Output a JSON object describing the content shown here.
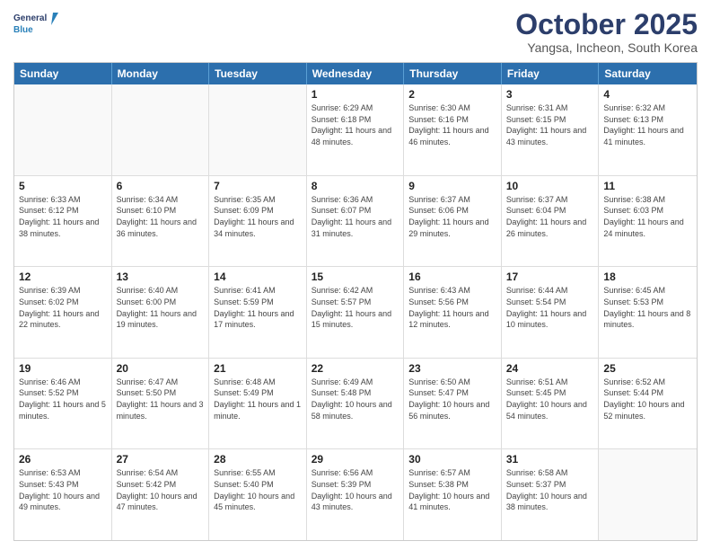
{
  "header": {
    "logo_line1": "General",
    "logo_line2": "Blue",
    "month_title": "October 2025",
    "location": "Yangsa, Incheon, South Korea"
  },
  "days_of_week": [
    "Sunday",
    "Monday",
    "Tuesday",
    "Wednesday",
    "Thursday",
    "Friday",
    "Saturday"
  ],
  "weeks": [
    [
      {
        "day": "",
        "empty": true
      },
      {
        "day": "",
        "empty": true
      },
      {
        "day": "",
        "empty": true
      },
      {
        "day": "1",
        "info": "Sunrise: 6:29 AM\nSunset: 6:18 PM\nDaylight: 11 hours\nand 48 minutes."
      },
      {
        "day": "2",
        "info": "Sunrise: 6:30 AM\nSunset: 6:16 PM\nDaylight: 11 hours\nand 46 minutes."
      },
      {
        "day": "3",
        "info": "Sunrise: 6:31 AM\nSunset: 6:15 PM\nDaylight: 11 hours\nand 43 minutes."
      },
      {
        "day": "4",
        "info": "Sunrise: 6:32 AM\nSunset: 6:13 PM\nDaylight: 11 hours\nand 41 minutes."
      }
    ],
    [
      {
        "day": "5",
        "info": "Sunrise: 6:33 AM\nSunset: 6:12 PM\nDaylight: 11 hours\nand 38 minutes."
      },
      {
        "day": "6",
        "info": "Sunrise: 6:34 AM\nSunset: 6:10 PM\nDaylight: 11 hours\nand 36 minutes."
      },
      {
        "day": "7",
        "info": "Sunrise: 6:35 AM\nSunset: 6:09 PM\nDaylight: 11 hours\nand 34 minutes."
      },
      {
        "day": "8",
        "info": "Sunrise: 6:36 AM\nSunset: 6:07 PM\nDaylight: 11 hours\nand 31 minutes."
      },
      {
        "day": "9",
        "info": "Sunrise: 6:37 AM\nSunset: 6:06 PM\nDaylight: 11 hours\nand 29 minutes."
      },
      {
        "day": "10",
        "info": "Sunrise: 6:37 AM\nSunset: 6:04 PM\nDaylight: 11 hours\nand 26 minutes."
      },
      {
        "day": "11",
        "info": "Sunrise: 6:38 AM\nSunset: 6:03 PM\nDaylight: 11 hours\nand 24 minutes."
      }
    ],
    [
      {
        "day": "12",
        "info": "Sunrise: 6:39 AM\nSunset: 6:02 PM\nDaylight: 11 hours\nand 22 minutes."
      },
      {
        "day": "13",
        "info": "Sunrise: 6:40 AM\nSunset: 6:00 PM\nDaylight: 11 hours\nand 19 minutes."
      },
      {
        "day": "14",
        "info": "Sunrise: 6:41 AM\nSunset: 5:59 PM\nDaylight: 11 hours\nand 17 minutes."
      },
      {
        "day": "15",
        "info": "Sunrise: 6:42 AM\nSunset: 5:57 PM\nDaylight: 11 hours\nand 15 minutes."
      },
      {
        "day": "16",
        "info": "Sunrise: 6:43 AM\nSunset: 5:56 PM\nDaylight: 11 hours\nand 12 minutes."
      },
      {
        "day": "17",
        "info": "Sunrise: 6:44 AM\nSunset: 5:54 PM\nDaylight: 11 hours\nand 10 minutes."
      },
      {
        "day": "18",
        "info": "Sunrise: 6:45 AM\nSunset: 5:53 PM\nDaylight: 11 hours\nand 8 minutes."
      }
    ],
    [
      {
        "day": "19",
        "info": "Sunrise: 6:46 AM\nSunset: 5:52 PM\nDaylight: 11 hours\nand 5 minutes."
      },
      {
        "day": "20",
        "info": "Sunrise: 6:47 AM\nSunset: 5:50 PM\nDaylight: 11 hours\nand 3 minutes."
      },
      {
        "day": "21",
        "info": "Sunrise: 6:48 AM\nSunset: 5:49 PM\nDaylight: 11 hours\nand 1 minute."
      },
      {
        "day": "22",
        "info": "Sunrise: 6:49 AM\nSunset: 5:48 PM\nDaylight: 10 hours\nand 58 minutes."
      },
      {
        "day": "23",
        "info": "Sunrise: 6:50 AM\nSunset: 5:47 PM\nDaylight: 10 hours\nand 56 minutes."
      },
      {
        "day": "24",
        "info": "Sunrise: 6:51 AM\nSunset: 5:45 PM\nDaylight: 10 hours\nand 54 minutes."
      },
      {
        "day": "25",
        "info": "Sunrise: 6:52 AM\nSunset: 5:44 PM\nDaylight: 10 hours\nand 52 minutes."
      }
    ],
    [
      {
        "day": "26",
        "info": "Sunrise: 6:53 AM\nSunset: 5:43 PM\nDaylight: 10 hours\nand 49 minutes."
      },
      {
        "day": "27",
        "info": "Sunrise: 6:54 AM\nSunset: 5:42 PM\nDaylight: 10 hours\nand 47 minutes."
      },
      {
        "day": "28",
        "info": "Sunrise: 6:55 AM\nSunset: 5:40 PM\nDaylight: 10 hours\nand 45 minutes."
      },
      {
        "day": "29",
        "info": "Sunrise: 6:56 AM\nSunset: 5:39 PM\nDaylight: 10 hours\nand 43 minutes."
      },
      {
        "day": "30",
        "info": "Sunrise: 6:57 AM\nSunset: 5:38 PM\nDaylight: 10 hours\nand 41 minutes."
      },
      {
        "day": "31",
        "info": "Sunrise: 6:58 AM\nSunset: 5:37 PM\nDaylight: 10 hours\nand 38 minutes."
      },
      {
        "day": "",
        "empty": true
      }
    ]
  ]
}
